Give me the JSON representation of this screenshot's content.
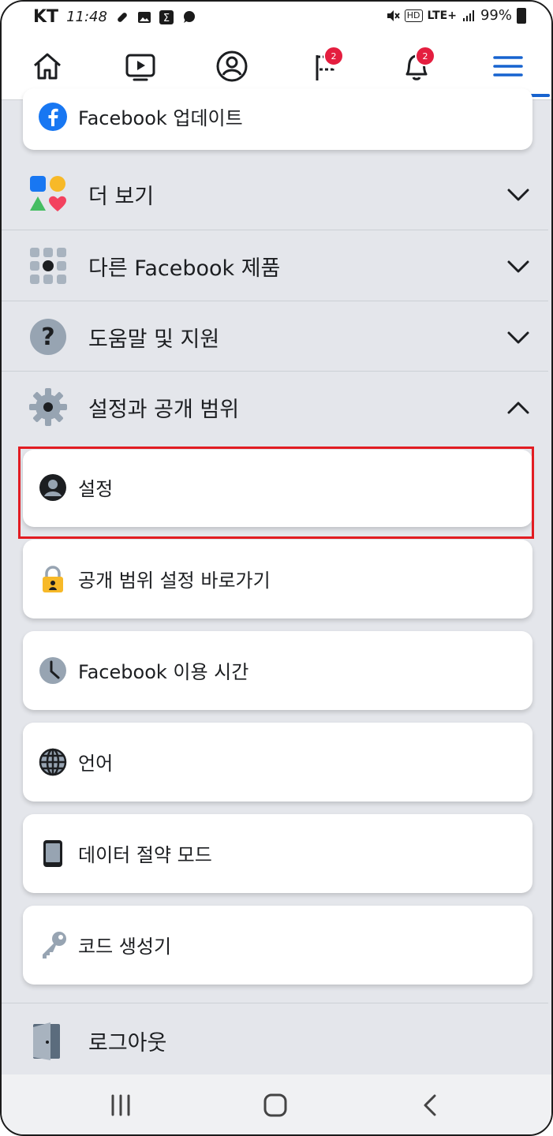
{
  "status_bar": {
    "carrier": "KT",
    "time": "11:48",
    "network_hd": "HD",
    "network": "LTE+",
    "battery": "99%"
  },
  "top_nav": {
    "items": [
      {
        "name": "home-icon"
      },
      {
        "name": "watch-icon"
      },
      {
        "name": "profile-icon"
      },
      {
        "name": "flag-icon",
        "badge": "2"
      },
      {
        "name": "bell-icon",
        "badge": "2"
      },
      {
        "name": "menu-icon",
        "active": true
      }
    ],
    "accent_color": "#1763cf",
    "badge_color": "#e41e3f"
  },
  "menu": {
    "update_card": {
      "label": "Facebook 업데이트"
    },
    "sections": [
      {
        "label": "더 보기",
        "state": "collapsed"
      },
      {
        "label": "다른 Facebook 제품",
        "state": "collapsed"
      },
      {
        "label": "도움말 및 지원",
        "state": "collapsed"
      },
      {
        "label": "설정과 공개 범위",
        "state": "expanded"
      }
    ],
    "settings_items": [
      {
        "label": "설정",
        "icon": "person-circle-icon",
        "highlighted": true
      },
      {
        "label": "공개 범위 설정 바로가기",
        "icon": "lock-icon"
      },
      {
        "label": "Facebook 이용 시간",
        "icon": "clock-icon"
      },
      {
        "label": "언어",
        "icon": "globe-icon"
      },
      {
        "label": "데이터 절약 모드",
        "icon": "phone-icon"
      },
      {
        "label": "코드 생성기",
        "icon": "key-icon"
      }
    ],
    "logout": {
      "label": "로그아웃"
    }
  },
  "highlight_color": "#e21c22"
}
